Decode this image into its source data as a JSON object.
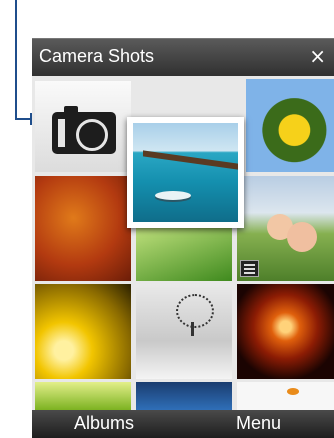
{
  "window": {
    "title": "Camera Shots",
    "close_symbol": "×"
  },
  "softkeys": {
    "left": "Albums",
    "right": "Menu"
  },
  "tiles": [
    {
      "id": "camera-launcher",
      "icon": "camera-icon"
    },
    {
      "id": "pier-photo",
      "selected": true
    },
    {
      "id": "sunflower-photo"
    },
    {
      "id": "autumn-leaf-photo"
    },
    {
      "id": "grass-photo"
    },
    {
      "id": "family-photo",
      "icon": "video-clip-icon"
    },
    {
      "id": "yellow-flower-photo"
    },
    {
      "id": "snow-tree-photo"
    },
    {
      "id": "flame-art-photo"
    },
    {
      "id": "green-photo"
    },
    {
      "id": "blue-photo"
    },
    {
      "id": "goldfish-photo"
    }
  ],
  "colors": {
    "callout": "#1f4e8c",
    "titlebar": "#3e3e3e",
    "bottombar": "#2a2a2a"
  }
}
